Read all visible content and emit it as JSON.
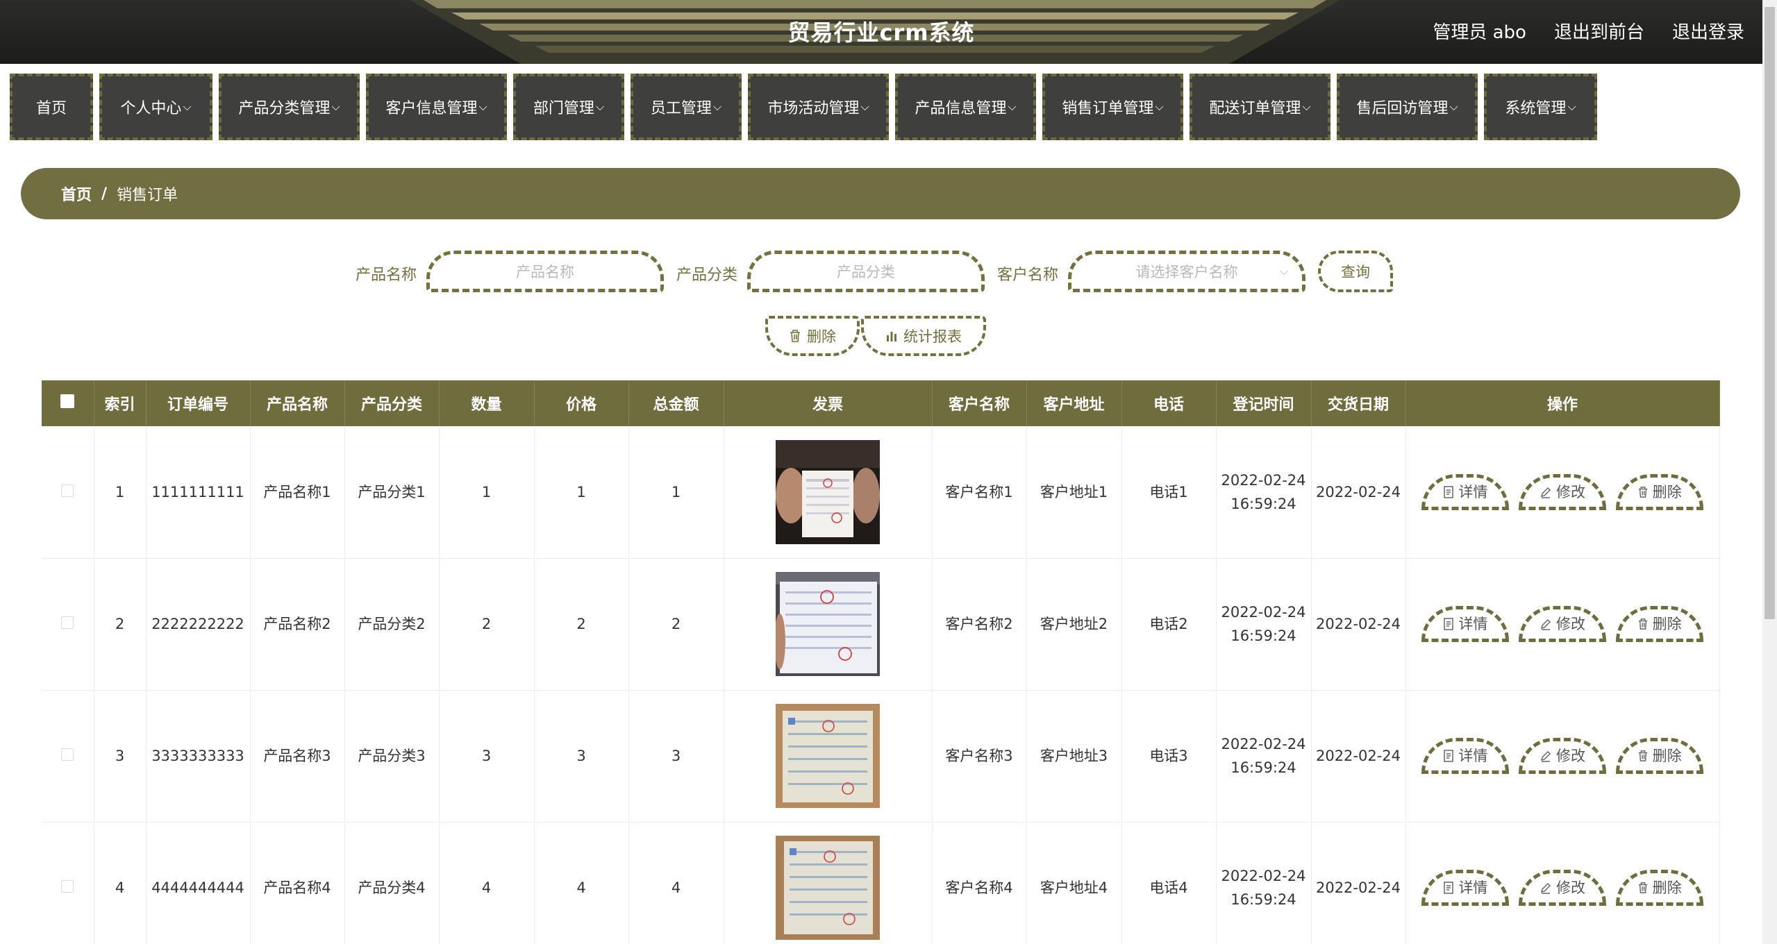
{
  "header": {
    "title": "贸易行业crm系统",
    "user_label": "管理员 abo",
    "front_label": "退出到前台",
    "logout_label": "退出登录"
  },
  "nav": {
    "items": [
      {
        "label": "首页",
        "dropdown": false
      },
      {
        "label": "个人中心",
        "dropdown": true
      },
      {
        "label": "产品分类管理",
        "dropdown": true
      },
      {
        "label": "客户信息管理",
        "dropdown": true
      },
      {
        "label": "部门管理",
        "dropdown": true
      },
      {
        "label": "员工管理",
        "dropdown": true
      },
      {
        "label": "市场活动管理",
        "dropdown": true
      },
      {
        "label": "产品信息管理",
        "dropdown": true
      },
      {
        "label": "销售订单管理",
        "dropdown": true
      },
      {
        "label": "配送订单管理",
        "dropdown": true
      },
      {
        "label": "售后回访管理",
        "dropdown": true
      },
      {
        "label": "系统管理",
        "dropdown": true
      }
    ]
  },
  "breadcrumb": {
    "home": "首页",
    "separator": "/",
    "current": "销售订单"
  },
  "search": {
    "product_name_label": "产品名称",
    "product_name_placeholder": "产品名称",
    "category_label": "产品分类",
    "category_placeholder": "产品分类",
    "customer_label": "客户名称",
    "customer_placeholder": "请选择客户名称",
    "query_label": "查询"
  },
  "toolbar": {
    "delete_label": "删除",
    "report_label": "统计报表"
  },
  "table": {
    "columns": [
      "索引",
      "订单编号",
      "产品名称",
      "产品分类",
      "数量",
      "价格",
      "总金额",
      "发票",
      "客户名称",
      "客户地址",
      "电话",
      "登记时间",
      "交货日期",
      "操作"
    ],
    "rows": [
      {
        "index": "1",
        "order_no": "1111111111",
        "product": "产品名称1",
        "category": "产品分类1",
        "qty": "1",
        "price": "1",
        "total": "1",
        "customer": "客户名称1",
        "address": "客户地址1",
        "phone": "电话1",
        "reg_time": "2022-02-24 16:59:24",
        "delivery": "2022-02-24"
      },
      {
        "index": "2",
        "order_no": "2222222222",
        "product": "产品名称2",
        "category": "产品分类2",
        "qty": "2",
        "price": "2",
        "total": "2",
        "customer": "客户名称2",
        "address": "客户地址2",
        "phone": "电话2",
        "reg_time": "2022-02-24 16:59:24",
        "delivery": "2022-02-24"
      },
      {
        "index": "3",
        "order_no": "3333333333",
        "product": "产品名称3",
        "category": "产品分类3",
        "qty": "3",
        "price": "3",
        "total": "3",
        "customer": "客户名称3",
        "address": "客户地址3",
        "phone": "电话3",
        "reg_time": "2022-02-24 16:59:24",
        "delivery": "2022-02-24"
      },
      {
        "index": "4",
        "order_no": "4444444444",
        "product": "产品名称4",
        "category": "产品分类4",
        "qty": "4",
        "price": "4",
        "total": "4",
        "customer": "客户名称4",
        "address": "客户地址4",
        "phone": "电话4",
        "reg_time": "2022-02-24 16:59:24",
        "delivery": "2022-02-24"
      }
    ],
    "actions": {
      "detail_label": "详情",
      "edit_label": "修改",
      "delete_label": "删除"
    }
  },
  "colors": {
    "accent": "#716f42",
    "header_bg": "#1c1d1b",
    "nav_bg": "#3f3f3e"
  }
}
